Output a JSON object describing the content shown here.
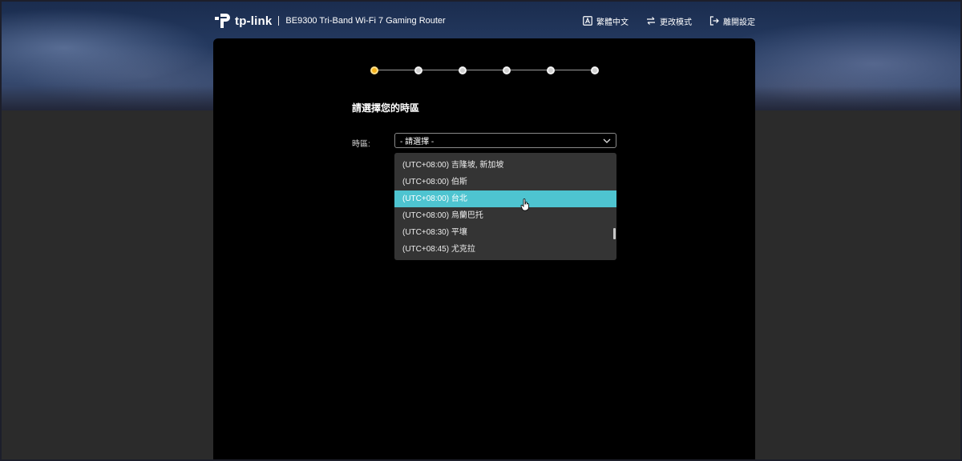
{
  "header": {
    "brand": "tp-link",
    "product": "BE9300 Tri-Band Wi-Fi 7 Gaming Router",
    "actions": [
      {
        "label": "繁體中文",
        "icon": "language-icon"
      },
      {
        "label": "更改模式",
        "icon": "switch-mode-icon"
      },
      {
        "label": "離開設定",
        "icon": "exit-icon"
      }
    ]
  },
  "wizard": {
    "steps_total": 6,
    "current_step": 1,
    "title": "請選擇您的時區",
    "field_label": "時區:",
    "select_value": "- 請選擇 -",
    "options": [
      "(UTC+08:00) 吉隆坡, 新加坡",
      "(UTC+08:00) 伯斯",
      "(UTC+08:00) 台北",
      "(UTC+08:00) 烏蘭巴托",
      "(UTC+08:30) 平壤",
      "(UTC+08:45) 尤克拉"
    ],
    "highlighted_option_index": 2
  },
  "colors": {
    "accent": "#4ec4d0",
    "active_step": "#f6b21b",
    "panel": "#000000",
    "dropdown": "#343434"
  }
}
